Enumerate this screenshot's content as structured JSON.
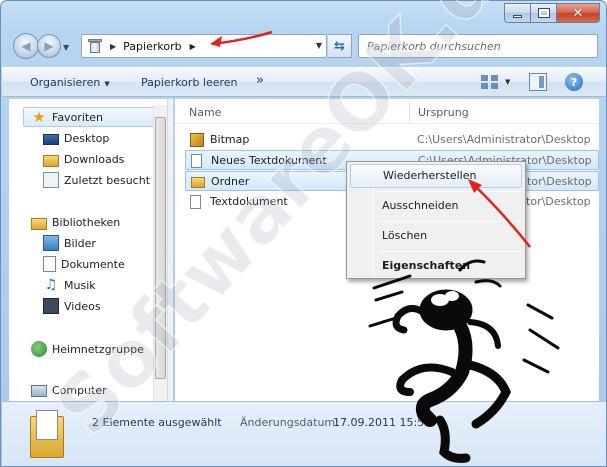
{
  "window": {
    "caption": {
      "minimize": "minimize",
      "maximize": "maximize",
      "close": "close"
    }
  },
  "address": {
    "location": "Papierkorb",
    "search_placeholder": "Papierkorb durchsuchen"
  },
  "toolbar": {
    "organize": "Organisieren",
    "empty_bin": "Papierkorb leeren",
    "more": "»"
  },
  "nav": {
    "favorites": "Favoriten",
    "desktop": "Desktop",
    "downloads": "Downloads",
    "recent": "Zuletzt besucht",
    "libraries": "Bibliotheken",
    "pictures": "Bilder",
    "documents": "Dokumente",
    "music": "Musik",
    "videos": "Videos",
    "homegroup": "Heimnetzgruppe",
    "computer": "Computer"
  },
  "list": {
    "col_name": "Name",
    "col_origin": "Ursprung",
    "rows": [
      {
        "name": "Bitmap",
        "origin": "C:\\Users\\Administrator\\Desktop",
        "selected": false
      },
      {
        "name": "Neues Textdokument",
        "origin": "C:\\Users\\Administrator\\Desktop",
        "selected": true
      },
      {
        "name": "Ordner",
        "origin": "C:\\Users\\Administrator\\Desktop",
        "selected": true
      },
      {
        "name": "Textdokument",
        "origin": "C:\\Users\\Administrator\\Desktop",
        "selected": false
      }
    ]
  },
  "context_menu": {
    "restore": "Wiederherstellen",
    "cut": "Ausschneiden",
    "delete": "Löschen",
    "properties": "Eigenschaften"
  },
  "details": {
    "count": "2 Elemente ausgewählt",
    "date_label": "Änderungsdatum:",
    "date_value": "17.09.2011 15:51"
  },
  "watermark": {
    "text": "SoftwareOK.de"
  },
  "colors": {
    "arrow": "#e0241c",
    "selection": "#d3e8fb",
    "accent": "#1e395b"
  }
}
